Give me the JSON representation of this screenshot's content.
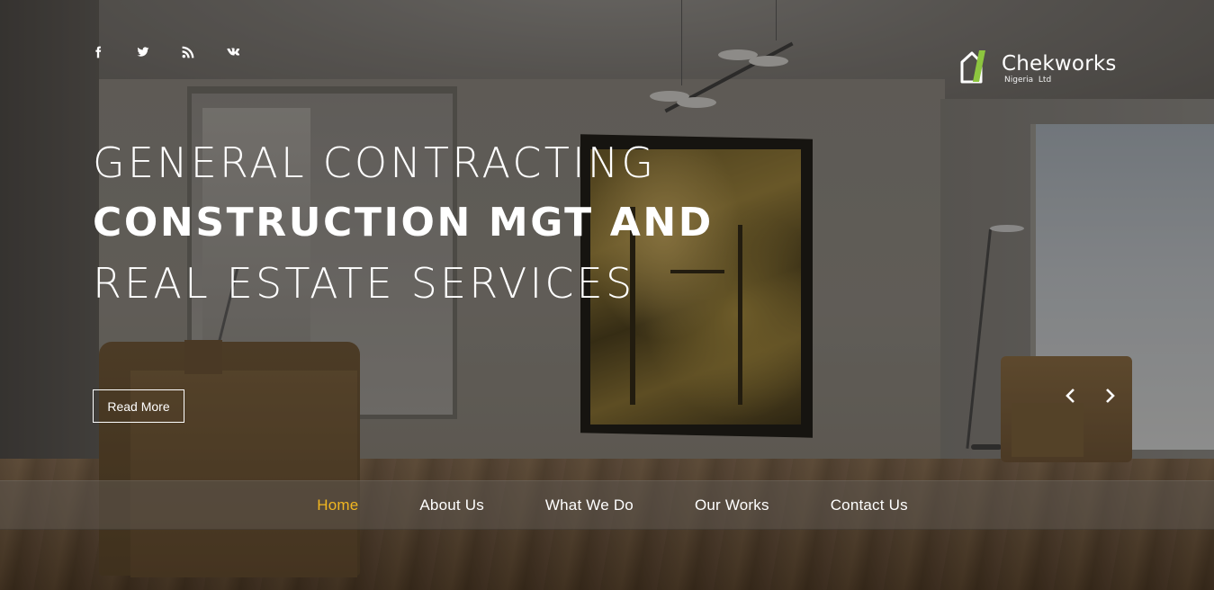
{
  "social": {
    "icons": [
      "facebook-icon",
      "twitter-icon",
      "rss-icon",
      "vk-icon"
    ]
  },
  "logo": {
    "name": "Chekworks",
    "tagline": "Nigeria  Ltd",
    "mark_color": "#8dc63f"
  },
  "hero": {
    "line1": "GENERAL CONTRACTING",
    "line2": "CONSTRUCTION MGT AND",
    "line3": "REAL ESTATE SERVICES",
    "cta_label": "Read More"
  },
  "slider": {
    "prev_icon": "chevron-left-icon",
    "next_icon": "chevron-right-icon"
  },
  "nav": {
    "active_color": "#f1b620",
    "items": [
      {
        "label": "Home",
        "active": true
      },
      {
        "label": "About Us",
        "active": false
      },
      {
        "label": "What We Do",
        "active": false
      },
      {
        "label": "Our Works",
        "active": false
      },
      {
        "label": "Contact Us",
        "active": false
      }
    ]
  }
}
